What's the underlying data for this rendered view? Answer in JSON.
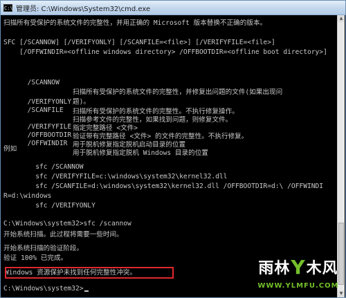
{
  "window": {
    "title": "管理员: C:\\Windows\\System32\\cmd.exe",
    "icon": "cmd-icon"
  },
  "console": {
    "lines": [
      "扫描所有受保护的系统文件的完整性，并用正确的 Microsoft 版本替换不正确的版本。",
      "",
      "SFC [/SCANNOW] [/VERIFYONLY] [/SCANFILE=<file>] [/VERIFYFILE=<file>]",
      "    [/OFFWINDIR=<offline windows directory> /OFFBOOTDIR=<offline boot directory>]",
      ""
    ],
    "options": [
      {
        "flag": "/SCANNOW",
        "desc": "扫描所有受保护的系统文件的完整性，并修复出问题的文件(如果出现问"
      },
      {
        "flag": "",
        "desc": "题)。"
      },
      {
        "flag": "/VERIFYONLY",
        "desc": "扫描所有受保护的系统文件的完整性。不执行修复操作。"
      },
      {
        "flag": "/SCANFILE",
        "desc": "扫描参考文件的完整性，如果找到问题，则修复文件。"
      },
      {
        "flag": "",
        "desc": "指定完整路径 <文件>"
      },
      {
        "flag": "/VERIFYFILE",
        "desc": "验证带有完整路径 <文件> 的文件的完整性。不执行修复。"
      },
      {
        "flag": "/OFFBOOTDIR",
        "desc": "用于脱机修复指定脱机启动目录的位置"
      },
      {
        "flag": "/OFFWINDIR",
        "desc": "用于脱机修复指定脱机 Windows 目录的位置"
      }
    ],
    "examples_heading": "例如",
    "examples": [
      "        sfc /SCANNOW",
      "        sfc /VERIFYFILE=c:\\windows\\system32\\kernel32.dll",
      "        sfc /SCANFILE=d:\\windows\\system32\\kernel32.dll /OFFBOOTDIR=d:\\ /OFFWINDI",
      "R=d:\\windows",
      "        sfc /VERIFYONLY"
    ],
    "command_line": "C:\\Windows\\system32>sfc /scannow",
    "output": [
      "开始系统扫描。此过程将需要一些时间。",
      "开始系统扫描的验证阶段。",
      "验证 100% 已完成。"
    ],
    "result": "Windows 资源保护未找到任何完整性冲突。",
    "prompt": "C:\\Windows\\system32>"
  },
  "watermark": {
    "logo_left": "雨林",
    "logo_mid": "Y",
    "logo_right": "木风",
    "url": "WWW.YLMFU.COM"
  },
  "colors": {
    "console_bg": "#000000",
    "console_text": "#c8c8c8",
    "highlight": "#e0282e",
    "watermark_green": "#74c02a"
  }
}
